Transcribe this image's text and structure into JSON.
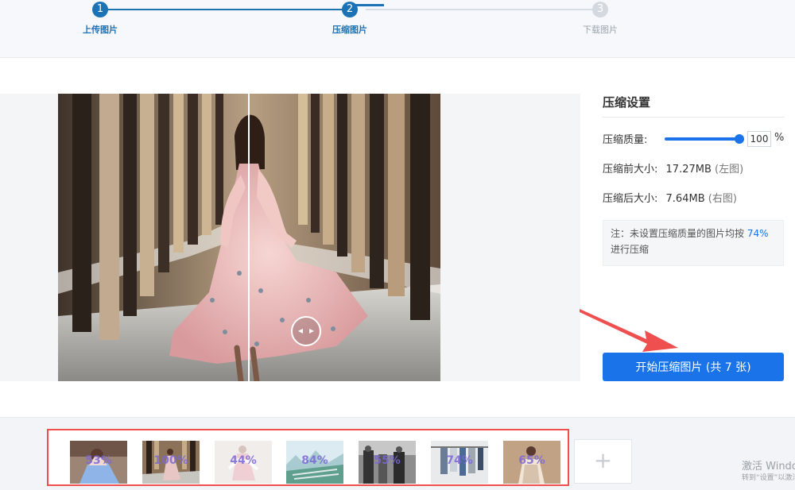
{
  "steps": [
    {
      "number": "1",
      "label": "上传图片"
    },
    {
      "number": "2",
      "label": "压缩图片"
    },
    {
      "number": "3",
      "label": "下载图片"
    }
  ],
  "preview": {
    "divider_icon": "left-right-arrows-icon"
  },
  "settings": {
    "title": "压缩设置",
    "quality_label": "压缩质量:",
    "quality_value": "100",
    "quality_fraction": 1,
    "percent_unit": "%",
    "before_label": "压缩前大小:",
    "before_size": "17.27MB",
    "before_note": "(左图)",
    "after_label": "压缩后大小:",
    "after_size": "7.64MB",
    "after_note": "(右图)",
    "note_text": "注：未设置压缩质量的图片均按",
    "note_percent": "74%",
    "note_suffix": "进行压缩"
  },
  "actions": {
    "start_compress": "开始压缩图片 (共 7 张)",
    "add_icon": "+"
  },
  "thumbnails": [
    {
      "percent": "53%",
      "icon": "woman-portrait-icon"
    },
    {
      "percent": "100%",
      "icon": "arcade-corridor-icon"
    },
    {
      "percent": "44%",
      "icon": "pink-dress-icon"
    },
    {
      "percent": "84%",
      "icon": "mountain-landscape-icon"
    },
    {
      "percent": "55%",
      "icon": "street-photo-icon"
    },
    {
      "percent": "74%",
      "icon": "clothes-rack-icon"
    },
    {
      "percent": "65%",
      "icon": "fashion-portrait-icon"
    }
  ],
  "watermark": {
    "title": "激活 Windows",
    "subtitle": "转到“设置”以激活 Windows。"
  },
  "colors": {
    "accent": "#1a73e8",
    "step_accent": "#1b73b5",
    "annotation": "#ef4f4f"
  }
}
